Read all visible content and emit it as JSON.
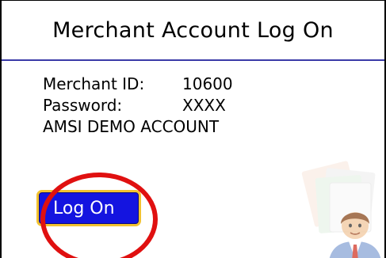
{
  "window": {
    "title": "Merchant Account Log On"
  },
  "account": {
    "merchant_id_label": "Merchant ID:",
    "merchant_id_value": "10600",
    "password_label": "Password:",
    "password_value": "XXXX",
    "account_name": "AMSI DEMO ACCOUNT"
  },
  "actions": {
    "logon_label": "Log On"
  },
  "colors": {
    "header_rule": "#3a3aa8",
    "button_fill": "#1414e0",
    "button_border": "#f2c230",
    "highlight": "#e01010"
  },
  "icons": {
    "watermark": "user-with-documents-icon"
  }
}
